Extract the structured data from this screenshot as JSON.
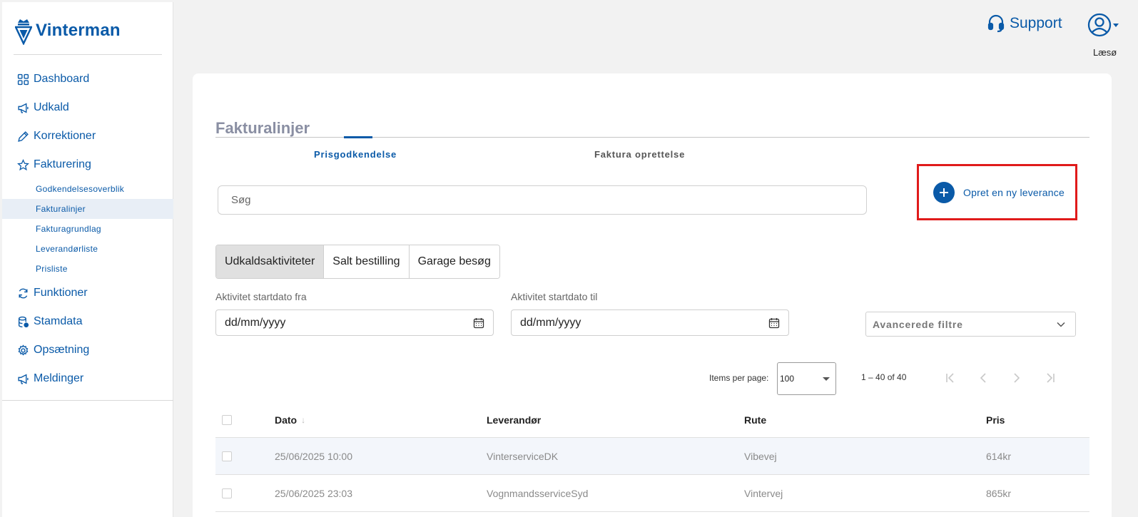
{
  "brand": {
    "name": "Vinterman",
    "color": "#0a5aa8"
  },
  "sidebar": {
    "items": [
      {
        "label": "Dashboard",
        "icon": "grid-icon"
      },
      {
        "label": "Udkald",
        "icon": "megaphone-icon"
      },
      {
        "label": "Korrektioner",
        "icon": "pencil-icon"
      },
      {
        "label": "Fakturering",
        "icon": "star-icon"
      }
    ],
    "subitems": [
      {
        "label": "Godkendelsesoverblik"
      },
      {
        "label": "Fakturalinjer",
        "active": true
      },
      {
        "label": "Fakturagrundlag"
      },
      {
        "label": "Leverandørliste"
      },
      {
        "label": "Prisliste"
      }
    ],
    "items_after": [
      {
        "label": "Funktioner",
        "icon": "refresh-icon"
      },
      {
        "label": "Stamdata",
        "icon": "database-icon"
      },
      {
        "label": "Opsætning",
        "icon": "gear-icon"
      },
      {
        "label": "Meldinger",
        "icon": "megaphone-icon"
      }
    ]
  },
  "topbar": {
    "support_label": "Support",
    "user_name": "Læsø"
  },
  "page": {
    "title": "Fakturalinjer",
    "tabs": [
      {
        "label": "Prisgodkendelse",
        "active": true
      },
      {
        "label": "Faktura oprettelse"
      }
    ],
    "search_placeholder": "Søg",
    "create_label": "Opret en ny leverance",
    "segments": [
      {
        "label": "Udkaldsaktiviteter",
        "active": true
      },
      {
        "label": "Salt bestilling"
      },
      {
        "label": "Garage besøg"
      }
    ],
    "date_from_label": "Aktivitet startdato fra",
    "date_to_label": "Aktivitet startdato til",
    "date_placeholder": "dd/mm/yyyy",
    "advanced_filters_label": "Avancerede filtre"
  },
  "pager": {
    "items_per_page_label": "Items per page:",
    "page_size": "100",
    "range": "1 – 40 of 40"
  },
  "table": {
    "headers": {
      "date": "Dato",
      "supplier": "Leverandør",
      "route": "Rute",
      "price": "Pris"
    },
    "rows": [
      {
        "date": "25/06/2025 10:00",
        "supplier": "VinterserviceDK",
        "route": "Vibevej",
        "price": "614kr"
      },
      {
        "date": "25/06/2025 23:03",
        "supplier": "VognmandsserviceSyd",
        "route": "Vintervej",
        "price": "865kr"
      }
    ]
  }
}
